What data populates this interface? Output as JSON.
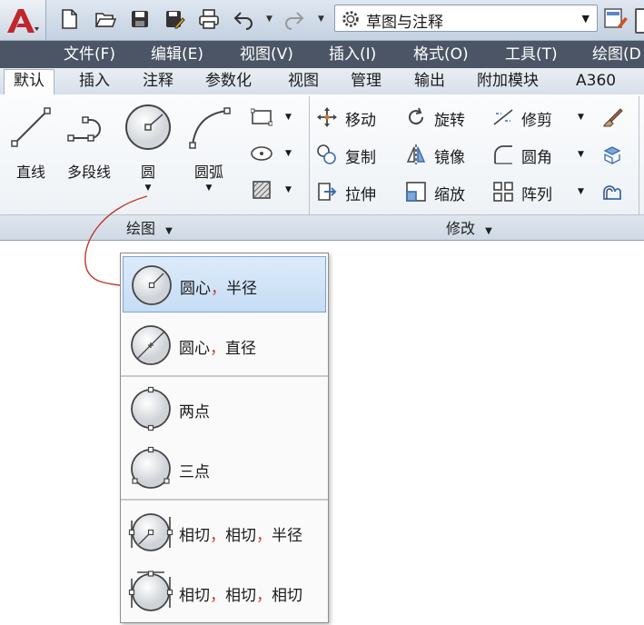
{
  "title_bar": {
    "workspace": "草图与注释"
  },
  "menu": [
    "文件(F)",
    "编辑(E)",
    "视图(V)",
    "插入(I)",
    "格式(O)",
    "工具(T)",
    "绘图(D"
  ],
  "tabs": [
    "默认",
    "插入",
    "注释",
    "参数化",
    "视图",
    "管理",
    "输出",
    "附加模块",
    "A360"
  ],
  "ribbon": {
    "draw_panel": {
      "title": "绘图",
      "buttons": [
        "直线",
        "多段线",
        "圆",
        "圆弧"
      ]
    },
    "modify_panel": {
      "title": "修改",
      "col1": [
        "移动",
        "复制",
        "拉伸"
      ],
      "col2": [
        "旋转",
        "镜像",
        "缩放"
      ],
      "col3": [
        "修剪",
        "圆角",
        "阵列"
      ]
    }
  },
  "circle_menu": {
    "items": [
      {
        "a": "圆心",
        "b": "半径",
        "selected": true
      },
      {
        "a": "圆心",
        "b": "直径"
      },
      {
        "a": "两点"
      },
      {
        "a": "三点"
      },
      {
        "a": "相切",
        "b": "相切",
        "c": "半径"
      },
      {
        "a": "相切",
        "b": "相切",
        "c": "相切"
      }
    ],
    "separator": "，"
  },
  "colors": {
    "menubar": "#4b5565",
    "selection": "#c6ddf5",
    "connector": "#c0392b",
    "app_logo": "#c0262c"
  }
}
